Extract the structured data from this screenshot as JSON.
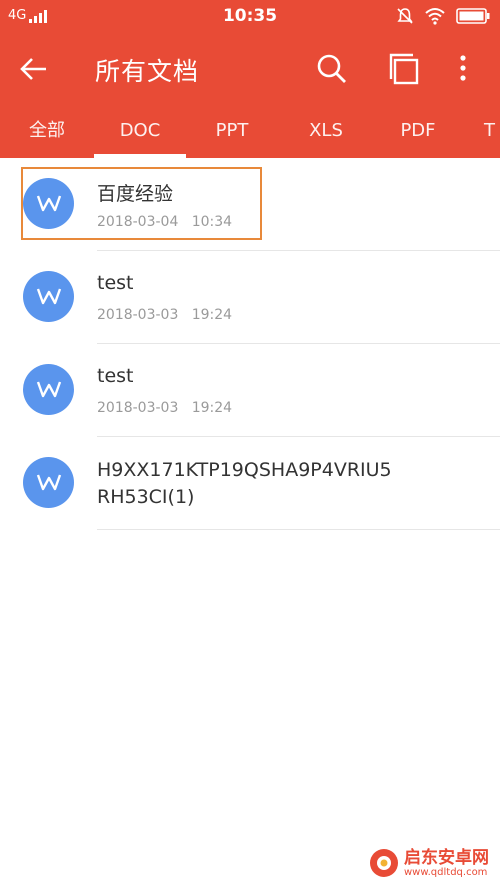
{
  "status_bar": {
    "network": "4G",
    "time": "10:35"
  },
  "app_bar": {
    "title": "所有文档"
  },
  "tabs": [
    {
      "label": "全部",
      "selected": false
    },
    {
      "label": "DOC",
      "selected": true
    },
    {
      "label": "PPT",
      "selected": false
    },
    {
      "label": "XLS",
      "selected": false
    },
    {
      "label": "PDF",
      "selected": false
    },
    {
      "label": "T",
      "selected": false
    }
  ],
  "files": [
    {
      "name": "百度经验",
      "date": "2018-03-04   10:34",
      "icon": "word-doc-icon",
      "highlighted": true
    },
    {
      "name": "test",
      "date": "2018-03-03   19:24",
      "icon": "word-doc-icon",
      "highlighted": false
    },
    {
      "name": "test",
      "date": "2018-03-03   19:24",
      "icon": "word-doc-icon",
      "highlighted": false
    },
    {
      "name": "H9XX171KTP19QSHA9P4VRIU5RH53CI(1)",
      "name_line1": "H9XX171KTP19QSHA9P4VRIU5",
      "name_line2": "RH53CI(1)",
      "date": "",
      "icon": "word-doc-icon",
      "highlighted": false
    }
  ],
  "watermark": {
    "text": "启东安卓网",
    "url": "www.qdltdq.com"
  },
  "colors": {
    "accent": "#e84b36",
    "icon_blue": "#5a95ed",
    "highlight": "#e8893a"
  }
}
